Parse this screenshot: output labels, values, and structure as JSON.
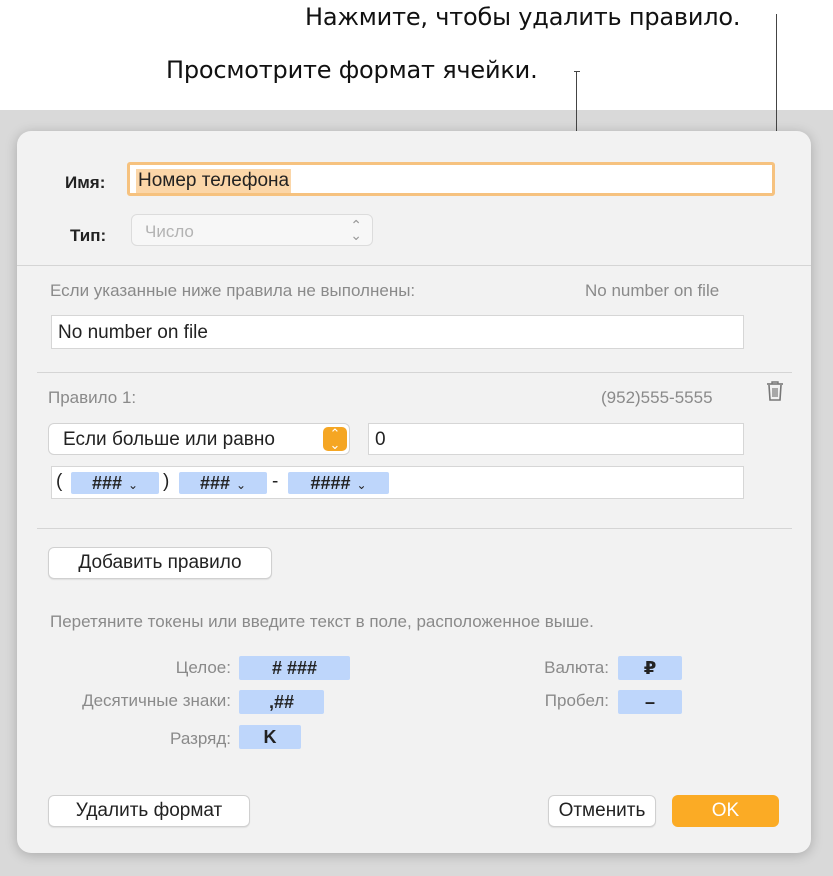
{
  "callouts": {
    "delete_rule": "Нажмите, чтобы удалить правило.",
    "view_format": "Просмотрите формат ячейки."
  },
  "dialog": {
    "name_label": "Имя:",
    "name_value": "Номер телефона",
    "type_label": "Тип:",
    "type_value": "Число",
    "fallback_caption": "Если указанные ниже правила не выполнены:",
    "fallback_preview": "No number on file",
    "fallback_value": "No number on file",
    "rule": {
      "label": "Правило 1:",
      "preview": "(952)555-5555",
      "condition": "Если больше или равно",
      "condition_value": "0",
      "format": {
        "open_paren": "(",
        "close_paren": ")",
        "dash": "-",
        "token1": "###",
        "token2": "###",
        "token3": "####"
      }
    },
    "add_rule_label": "Добавить правило",
    "hint": "Перетяните токены или введите текст в поле, расположенное выше.",
    "tokens": {
      "integer_label": "Целое:",
      "integer_token": "# ###",
      "decimals_label": "Десятичные знаки:",
      "decimals_token": ",##",
      "scale_label": "Разряд:",
      "scale_token": "K",
      "currency_label": "Валюта:",
      "currency_token": "₽",
      "space_label": "Пробел:",
      "space_token": "–"
    },
    "delete_format_label": "Удалить формат",
    "cancel_label": "Отменить",
    "ok_label": "OK"
  },
  "colors": {
    "accent": "#fbab25",
    "focus_ring": "#f6c27f",
    "token_bg": "#bed6fb"
  }
}
